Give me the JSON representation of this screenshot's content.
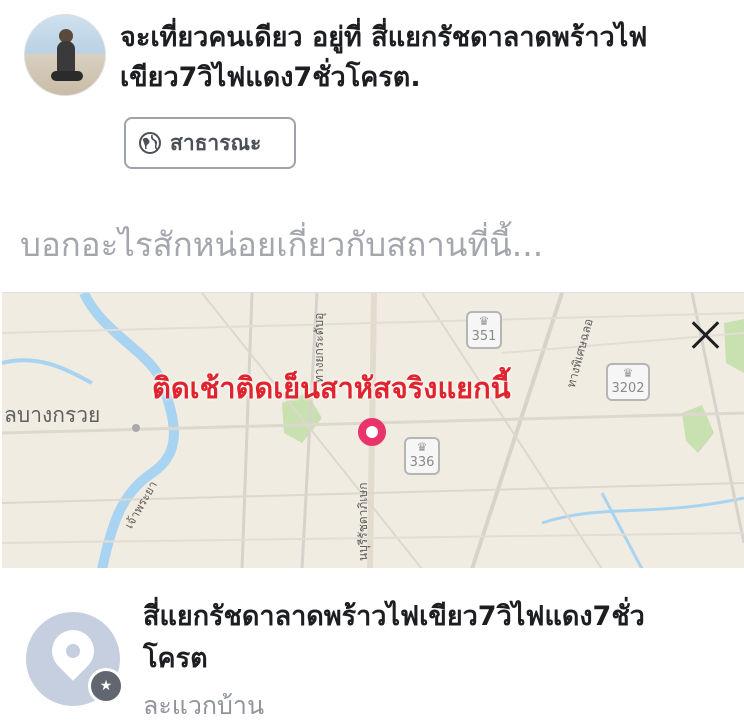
{
  "post": {
    "status_prefix": "จะเที่ยวคนเดียว อยู่ที่ ",
    "status_place": "สี่แยกรัชดาลาดพร้าวไฟเขียว7วิไฟแดง7ชั่วโครต",
    "status_suffix": ".",
    "avatar_icon": "profile-photo",
    "privacy_label": "สาธารณะ",
    "privacy_icon": "globe-icon",
    "compose_placeholder": "บอกอะไรสักหน่อยเกี่ยวกับสถานที่นี้..."
  },
  "map": {
    "overlay_text": "ติดเช้าติดเย็นสาหัสจริงแยกนี้",
    "district_label": "ลบางกรวย",
    "road_shields": [
      "351",
      "3202",
      "336"
    ],
    "street_labels": [
      "ทางยกระดับอุ",
      "ทางพิเศษฉลอ",
      "เจ้าพระยา",
      "นบุรีรัชดาภิเษก"
    ],
    "pin_icon": "location-pin-marker",
    "close_icon": "close-icon",
    "colors": {
      "pin": "#e8336b",
      "overlay_text": "#e0242e",
      "river": "#a8d4f2",
      "park": "#c9e0b0"
    }
  },
  "place": {
    "name": "สี่แยกรัชดาลาดพร้าวไฟเขียว7วิไฟแดง7ชั่วโครต",
    "category": "ละแวกบ้าน",
    "icon": "place-pin-icon",
    "badge_icon": "star-badge-icon"
  }
}
